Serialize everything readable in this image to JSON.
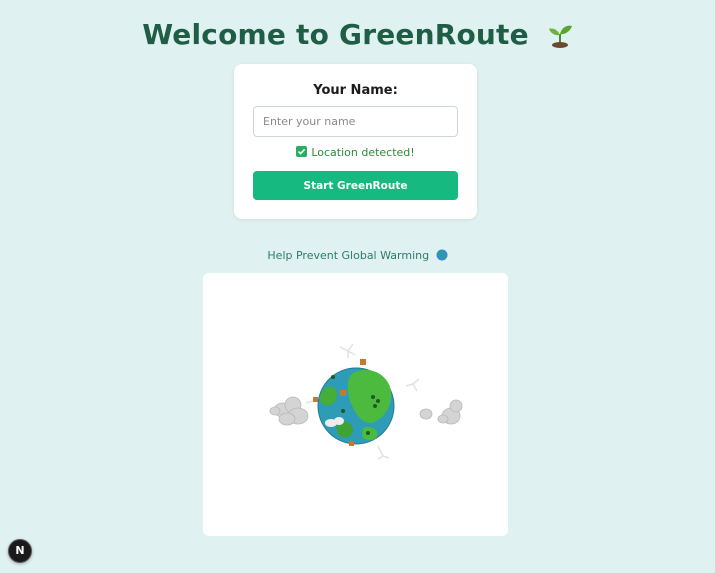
{
  "header": {
    "title": "Welcome to GreenRoute",
    "icon": "seedling-icon"
  },
  "form": {
    "name_label": "Your Name:",
    "name_input": {
      "value": "",
      "placeholder": "Enter your name"
    },
    "location_status": "Location detected!",
    "location_checked": true,
    "submit_label": "Start GreenRoute"
  },
  "tagline": {
    "text": "Help Prevent Global Warming",
    "icon": "earth-globe-icon"
  },
  "scene": {
    "subject": "earth-globe-3d-icon"
  },
  "dev_badge": {
    "label": "N"
  },
  "colors": {
    "background": "#dff1f1",
    "title": "#1f5e44",
    "button": "#16b980",
    "status": "#2c8b3a",
    "tagline": "#2f7a6c"
  }
}
